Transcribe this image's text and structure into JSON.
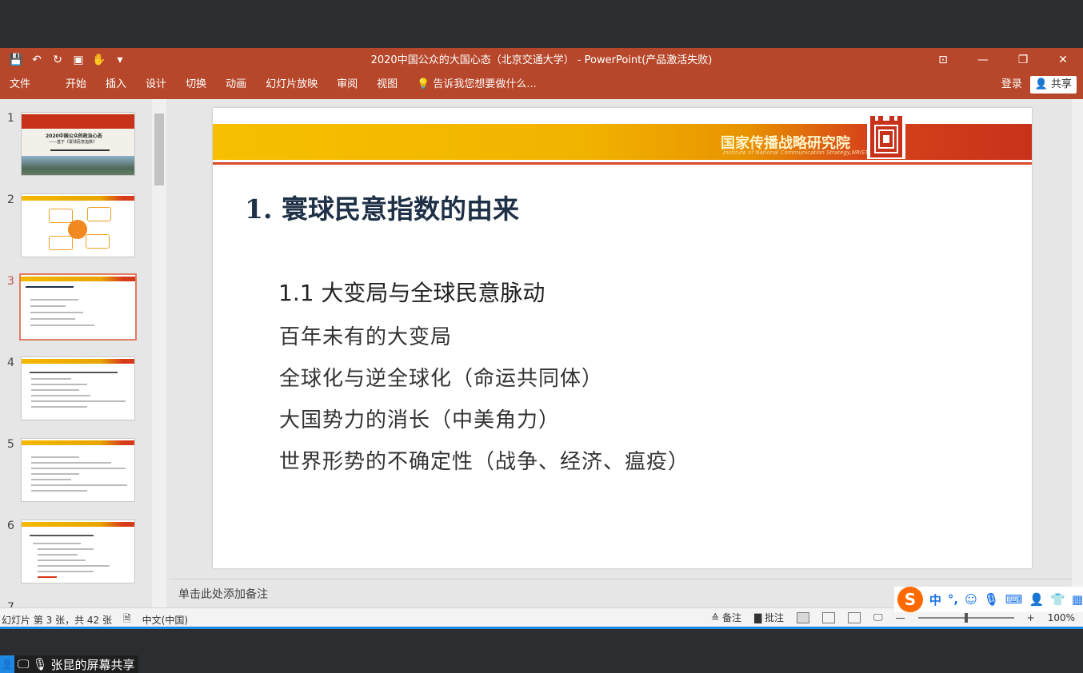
{
  "window": {
    "title": "2020中国公众的大国心态（北京交通大学） - PowerPoint(产品激活失败)",
    "controls": [
      "⊡",
      "—",
      "❐",
      "✕"
    ]
  },
  "qat": [
    "💾",
    "↶",
    "↻",
    "▣",
    "✋",
    "▾"
  ],
  "menu": {
    "items": [
      "文件",
      "开始",
      "插入",
      "设计",
      "切换",
      "动画",
      "幻灯片放映",
      "审阅",
      "视图"
    ],
    "tell_me": "告诉我您想要做什么...",
    "login": "登录",
    "share": "共享"
  },
  "thumbnails": [
    {
      "num": "1"
    },
    {
      "num": "2"
    },
    {
      "num": "3"
    },
    {
      "num": "4"
    },
    {
      "num": "5"
    },
    {
      "num": "6"
    },
    {
      "num": "7"
    }
  ],
  "thumb1": {
    "title": "2020中国公众的政治心态",
    "sub": "——基于《寰球民意指数》"
  },
  "slide": {
    "banner_cn": "国家传播战略研究院",
    "banner_en": "Institute of National Communication Strategy,NRIST",
    "title": "1. 寰球民意指数的由来",
    "subtitle": "1.1  大变局与全球民意脉动",
    "bullets": [
      "百年未有的大变局",
      "全球化与逆全球化（命运共同体）",
      "大国势力的消长（中美角力）",
      "世界形势的不确定性（战争、经济、瘟疫）"
    ]
  },
  "notes": "单击此处添加备注",
  "status": {
    "slide_count": "幻灯片 第 3 张，共 42 张",
    "language": "中文(中国)",
    "notes_btn": "备注",
    "comments_btn": "批注",
    "zoom": "100%"
  },
  "ime": {
    "mode": "中",
    "punct": "°,"
  },
  "screen_share": "张昆的屏幕共享",
  "colors": {
    "accent": "#b7472a",
    "banner_yellow": "#f6c000",
    "banner_red": "#c8321a"
  }
}
